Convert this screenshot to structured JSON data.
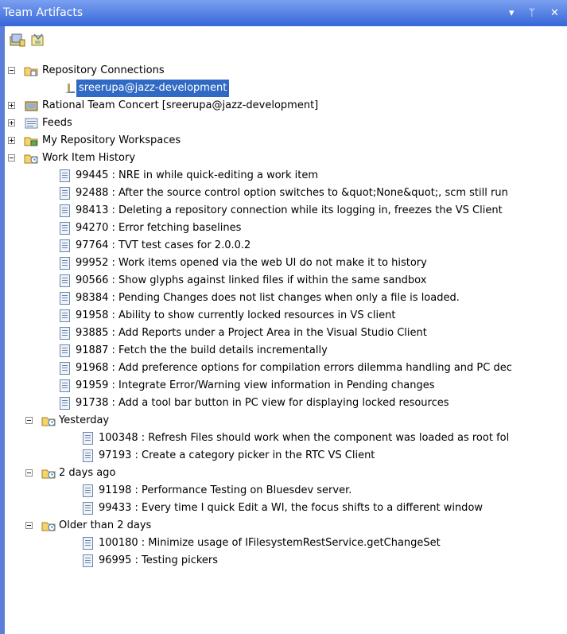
{
  "panel": {
    "title": "Team Artifacts",
    "controls": {
      "menu": "▾",
      "pin": "ᛘ",
      "close": "✕"
    }
  },
  "tree": {
    "repository_connections": {
      "label": "Repository Connections",
      "children": [
        {
          "label": "sreerupa@jazz-development",
          "selected": true
        }
      ]
    },
    "rtc": {
      "label": "Rational Team Concert [sreerupa@jazz-development]"
    },
    "feeds": {
      "label": "Feeds"
    },
    "workspaces": {
      "label": "My Repository Workspaces"
    },
    "history": {
      "label": "Work Item History",
      "items": [
        "99445 : NRE in while quick-editing a work item",
        "92488 : After the source control option switches to &quot;None&quot;, scm still run",
        "98413 : Deleting a repository connection while its logging in, freezes the VS Client",
        "94270 : Error fetching baselines",
        "97764 : TVT test cases for 2.0.0.2",
        "99952 : Work items opened via the web UI do not make it to history",
        "90566 : Show glyphs against linked files if within the same sandbox",
        "98384 : Pending Changes does not list changes when only a file is loaded.",
        "91958 : Ability to show currently locked resources in VS client",
        "93885 : Add Reports under a Project Area in the Visual Studio Client",
        "91887 : Fetch the the build details incrementally",
        "91968 : Add preference options for compilation errors dilemma handling and PC dec",
        "91959 : Integrate Error/Warning view information in Pending changes",
        "91738 : Add a tool bar button in PC view for displaying locked resources"
      ],
      "groups": [
        {
          "label": "Yesterday",
          "items": [
            "100348 : Refresh Files should work when the component was loaded as root fol",
            "97193 : Create a category picker in the RTC VS Client"
          ]
        },
        {
          "label": "2 days ago",
          "items": [
            "91198 : Performance Testing on Bluesdev server.",
            "99433 : Every time I quick Edit a WI, the focus shifts to a different window"
          ]
        },
        {
          "label": "Older than 2 days",
          "items": [
            "100180 : Minimize usage of IFilesystemRestService.getChangeSet",
            "96995 : Testing pickers"
          ]
        }
      ]
    }
  }
}
